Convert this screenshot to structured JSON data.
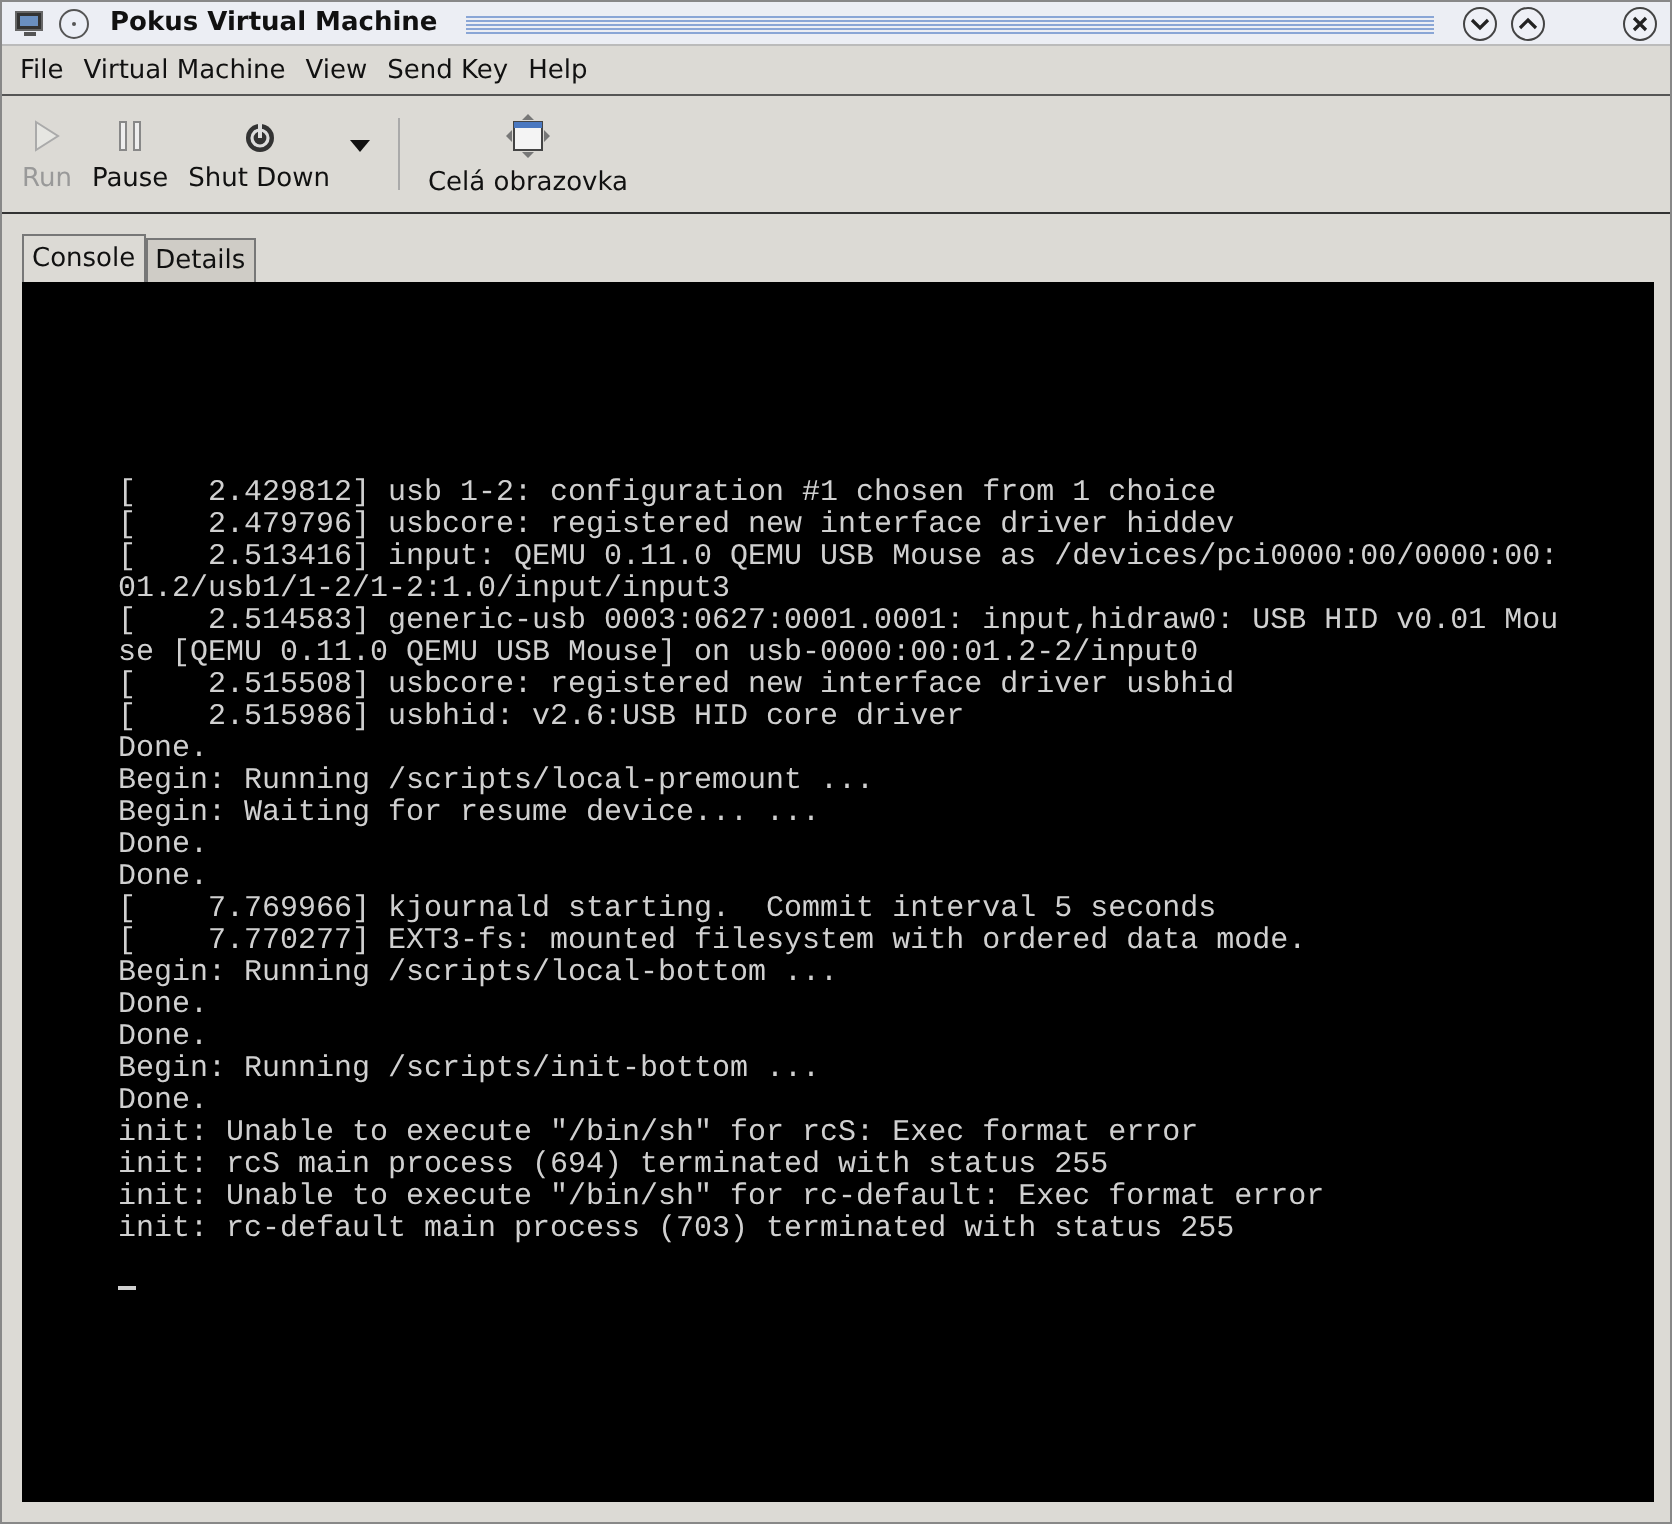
{
  "window": {
    "title": "Pokus Virtual Machine"
  },
  "menu": [
    {
      "label": "File"
    },
    {
      "label": "Virtual Machine"
    },
    {
      "label": "View"
    },
    {
      "label": "Send Key"
    },
    {
      "label": "Help"
    }
  ],
  "toolbar": [
    {
      "kind": "run",
      "label": "Run",
      "disabled": true
    },
    {
      "kind": "pause",
      "label": "Pause",
      "disabled": false
    },
    {
      "kind": "shutdown",
      "label": "Shut Down",
      "disabled": false
    },
    {
      "kind": "dropdown",
      "disabled": false
    },
    {
      "kind": "separator"
    },
    {
      "kind": "fullscreen",
      "label": "Celá obrazovka",
      "disabled": false
    }
  ],
  "tabs": [
    {
      "label": "Console",
      "selected": true
    },
    {
      "label": "Details",
      "selected": false
    }
  ],
  "console": {
    "lines": [
      "[    2.429812] usb 1-2: configuration #1 chosen from 1 choice",
      "[    2.479796] usbcore: registered new interface driver hiddev",
      "[    2.513416] input: QEMU 0.11.0 QEMU USB Mouse as /devices/pci0000:00/0000:00:",
      "01.2/usb1/1-2/1-2:1.0/input/input3",
      "[    2.514583] generic-usb 0003:0627:0001.0001: input,hidraw0: USB HID v0.01 Mou",
      "se [QEMU 0.11.0 QEMU USB Mouse] on usb-0000:00:01.2-2/input0",
      "[    2.515508] usbcore: registered new interface driver usbhid",
      "[    2.515986] usbhid: v2.6:USB HID core driver",
      "Done.",
      "Begin: Running /scripts/local-premount ...",
      "Begin: Waiting for resume device... ...",
      "Done.",
      "Done.",
      "[    7.769966] kjournald starting.  Commit interval 5 seconds",
      "[    7.770277] EXT3-fs: mounted filesystem with ordered data mode.",
      "Begin: Running /scripts/local-bottom ...",
      "Done.",
      "Done.",
      "Begin: Running /scripts/init-bottom ...",
      "Done.",
      "init: Unable to execute \"/bin/sh\" for rcS: Exec format error",
      "init: rcS main process (694) terminated with status 255",
      "init: Unable to execute \"/bin/sh\" for rc-default: Exec format error",
      "init: rc-default main process (703) terminated with status 255"
    ]
  }
}
